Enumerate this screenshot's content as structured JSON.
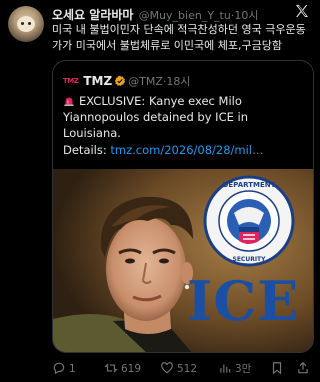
{
  "tweet": {
    "display_name": "오세요 알라바마",
    "handle": "@Muy_bien_Y_tu",
    "separator": "·",
    "time": "10시",
    "text_line1": "미국 내 불법이민자 단속에 적극찬성하던 영국 극우운동",
    "text_line2": "가가 미국에서 불법체류로 이민국에 체포,구금당함"
  },
  "quote": {
    "logo_text": "TMZ",
    "name": "TMZ",
    "handle": "@TMZ",
    "separator": "·",
    "time": "18시",
    "text_line1": "EXCLUSIVE: Kanye exec Milo",
    "text_line2": "Yiannopoulos detained by ICE in Louisiana.",
    "details_label": "Details: ",
    "details_link": "tmz.com/2026/08/28/mil…",
    "image": {
      "ice_text": "ICE",
      "seal_text": "U.S. DEPARTMENT OF HOMELAND SECURITY"
    }
  },
  "actions": {
    "reply_count": "1",
    "retweet_count": "619",
    "like_count": "512",
    "views_count": "3만"
  },
  "colors": {
    "background": "#000000",
    "text": "#e7e9ea",
    "muted": "#71767b",
    "link": "#1d9bf0",
    "border": "#2f3336",
    "ice_blue": "#1a4fa3"
  }
}
